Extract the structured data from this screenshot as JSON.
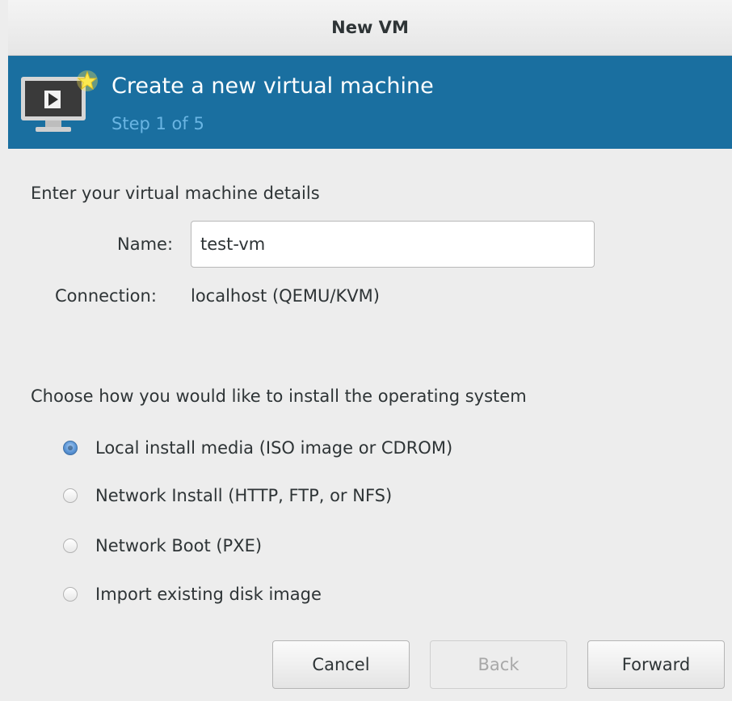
{
  "window": {
    "title": "New VM"
  },
  "banner": {
    "title": "Create a new virtual machine",
    "step": "Step 1 of 5",
    "icon": "monitor-play-star-icon",
    "color": "#1a6fa0",
    "step_color": "#6ab5e3"
  },
  "details": {
    "heading": "Enter your virtual machine details",
    "name_label": "Name:",
    "name_value": "test-vm",
    "connection_label": "Connection:",
    "connection_value": "localhost (QEMU/KVM)"
  },
  "install": {
    "heading": "Choose how you would like to install the operating system",
    "selected_index": 0,
    "options": [
      {
        "label": "Local install media (ISO image or CDROM)",
        "checked": true
      },
      {
        "label": "Network Install (HTTP, FTP, or NFS)",
        "checked": false
      },
      {
        "label": "Network Boot (PXE)",
        "checked": false
      },
      {
        "label": "Import existing disk image",
        "checked": false
      }
    ]
  },
  "buttons": {
    "cancel": "Cancel",
    "back": "Back",
    "forward": "Forward",
    "back_enabled": false
  }
}
